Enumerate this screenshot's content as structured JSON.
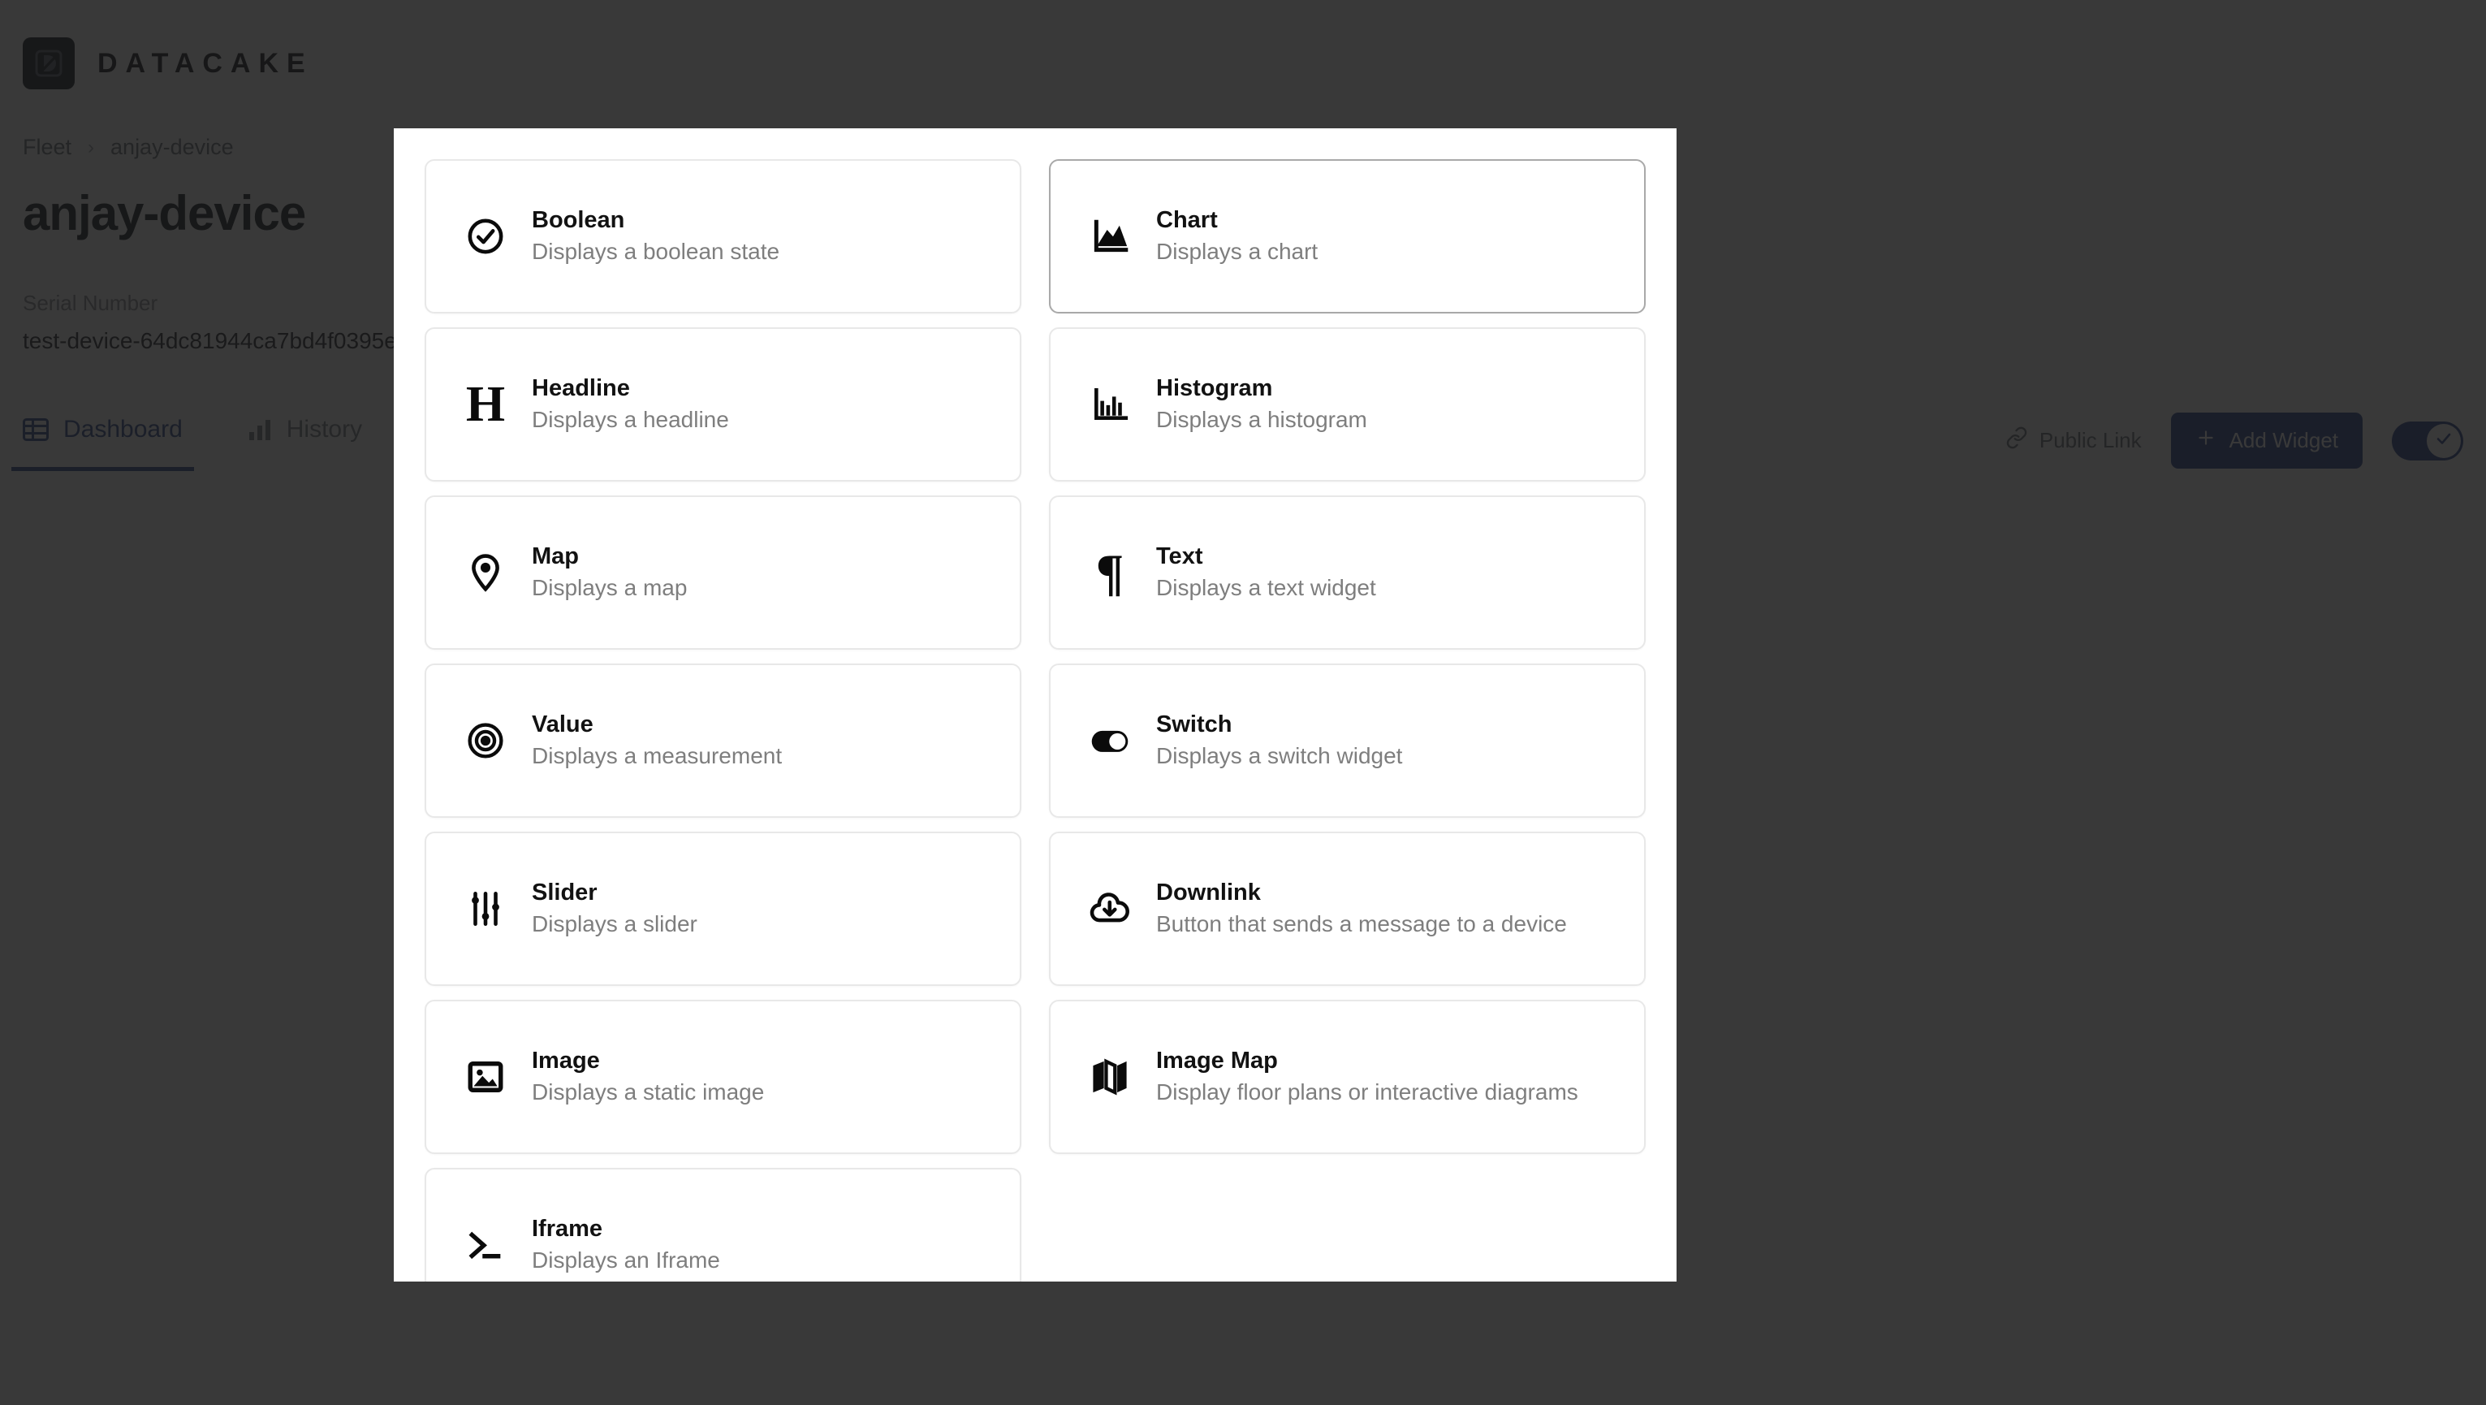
{
  "app": {
    "brand_name": "DATACAKE",
    "logo_icon": "datacake-logo-icon"
  },
  "breadcrumb": {
    "root": "Fleet",
    "separator": "›",
    "current": "anjay-device"
  },
  "device": {
    "title": "anjay-device",
    "serial_label": "Serial Number",
    "serial_value": "test-device-64dc81944ca7bd4f0395e"
  },
  "tabs": [
    {
      "label": "Dashboard",
      "icon": "table-grid-icon",
      "active": true
    },
    {
      "label": "History",
      "icon": "bar-chart-icon",
      "active": false
    }
  ],
  "header_actions": {
    "public_link_label": "Public Link",
    "public_link_icon": "link-icon",
    "add_widget_label": "Add Widget",
    "add_widget_icon": "plus-icon",
    "edit_toggle_state": "on",
    "edit_toggle_icon": "check-icon"
  },
  "modal": {
    "widgets": [
      {
        "title": "Boolean",
        "desc": "Displays a boolean state",
        "icon": "check-circle-icon",
        "column": "left",
        "hovered": false
      },
      {
        "title": "Chart",
        "desc": "Displays a chart",
        "icon": "area-chart-icon",
        "column": "right",
        "hovered": true
      },
      {
        "title": "Headline",
        "desc": "Displays a headline",
        "icon": "heading-h-icon",
        "column": "left",
        "hovered": false
      },
      {
        "title": "Histogram",
        "desc": "Displays a histogram",
        "icon": "histogram-icon",
        "column": "right",
        "hovered": false
      },
      {
        "title": "Map",
        "desc": "Displays a map",
        "icon": "map-pin-icon",
        "column": "left",
        "hovered": false
      },
      {
        "title": "Text",
        "desc": "Displays a text widget",
        "icon": "pilcrow-icon",
        "column": "right",
        "hovered": false
      },
      {
        "title": "Value",
        "desc": "Displays a measurement",
        "icon": "bullseye-icon",
        "column": "left",
        "hovered": false
      },
      {
        "title": "Switch",
        "desc": "Displays a switch widget",
        "icon": "toggle-icon",
        "column": "right",
        "hovered": false
      },
      {
        "title": "Slider",
        "desc": "Displays a slider",
        "icon": "sliders-icon",
        "column": "left",
        "hovered": false
      },
      {
        "title": "Downlink",
        "desc": "Button that sends a message to a device",
        "icon": "cloud-download-icon",
        "column": "right",
        "hovered": false
      },
      {
        "title": "Image",
        "desc": "Displays a static image",
        "icon": "image-icon",
        "column": "left",
        "hovered": false
      },
      {
        "title": "Image Map",
        "desc": "Display floor plans or interactive diagrams",
        "icon": "folded-map-icon",
        "column": "right",
        "hovered": false
      },
      {
        "title": "Iframe",
        "desc": "Displays an Iframe",
        "icon": "terminal-prompt-icon",
        "column": "left",
        "hovered": false
      }
    ]
  },
  "colors": {
    "accent": "#26408c",
    "overlay": "#181818",
    "card_border": "#e8e8e8",
    "card_border_hover": "#a9a9a9"
  }
}
